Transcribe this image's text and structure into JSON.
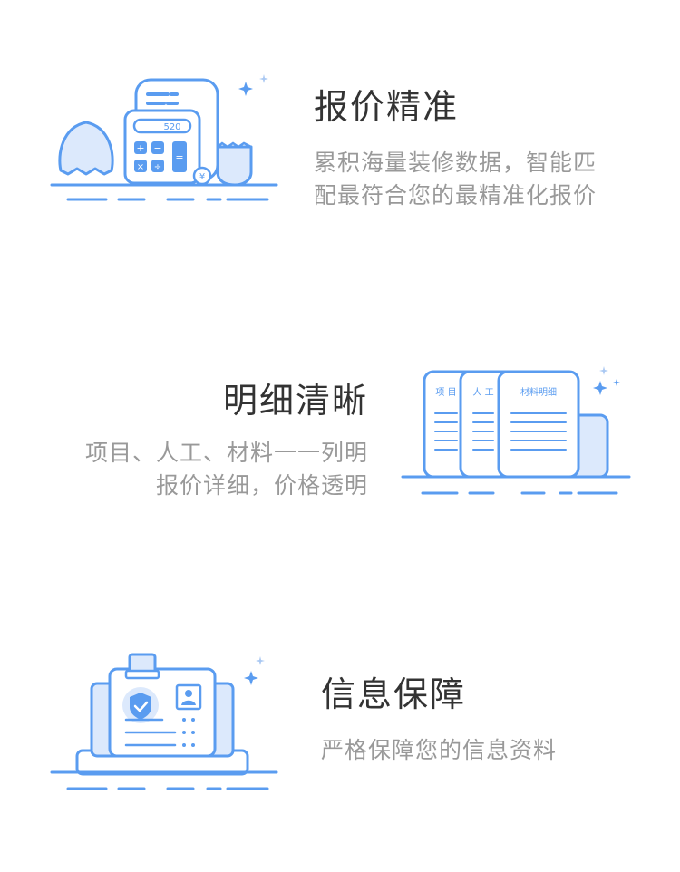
{
  "features": [
    {
      "title": "报价精准",
      "desc_lines": [
        "累积海量装修数据，智能匹",
        "配最符合您的最精准化报价"
      ],
      "icon": "calculator-icon",
      "calc_display": "520",
      "coin_symbol": "¥"
    },
    {
      "title": "明细清晰",
      "desc_lines": [
        "项目、人工、材料一一列明",
        "报价详细，价格透明"
      ],
      "icon": "document-list-icon",
      "doc_labels": [
        "项 目",
        "人 工",
        "材料明细"
      ]
    },
    {
      "title": "信息保障",
      "desc_lines": [
        "严格保障您的信息资料"
      ],
      "icon": "id-card-shield-icon"
    }
  ],
  "colors": {
    "stroke": "#5a9cf0",
    "fill_light": "#dce9fc",
    "title": "#333333",
    "desc": "#999999"
  }
}
